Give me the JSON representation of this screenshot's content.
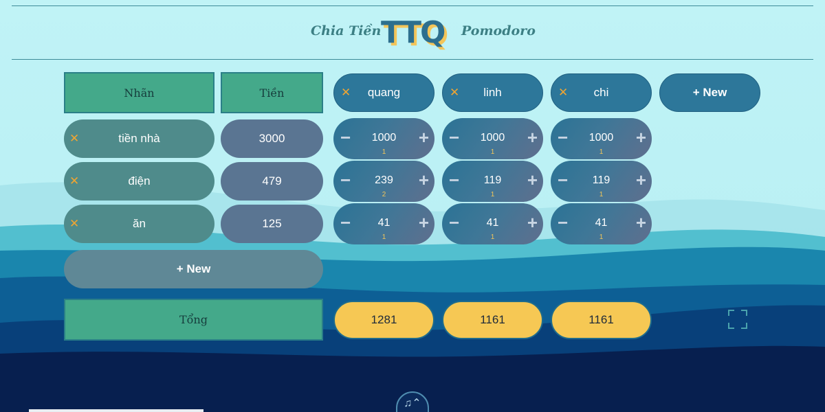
{
  "header": {
    "nav_left": "Chia Tiền",
    "logo": "TTQ",
    "nav_right": "Pomodoro"
  },
  "table": {
    "label_header": "Nhãn",
    "amount_header": "Tiền",
    "people": [
      "quang",
      "linh",
      "chi"
    ],
    "new_person_label": "+ New",
    "rows": [
      {
        "label": "tiền nhà",
        "amount": "3000",
        "shares": [
          {
            "value": "1000",
            "weight": "1"
          },
          {
            "value": "1000",
            "weight": "1"
          },
          {
            "value": "1000",
            "weight": "1"
          }
        ]
      },
      {
        "label": "điện",
        "amount": "479",
        "shares": [
          {
            "value": "239",
            "weight": "2"
          },
          {
            "value": "119",
            "weight": "1"
          },
          {
            "value": "119",
            "weight": "1"
          }
        ]
      },
      {
        "label": "ăn",
        "amount": "125",
        "shares": [
          {
            "value": "41",
            "weight": "1"
          },
          {
            "value": "41",
            "weight": "1"
          },
          {
            "value": "41",
            "weight": "1"
          }
        ]
      }
    ],
    "new_row_label": "+ New",
    "total_label": "Tổng",
    "totals": [
      "1281",
      "1161",
      "1161"
    ]
  },
  "icons": {
    "remove": "close-icon",
    "decrease": "minus-icon",
    "increase": "plus-icon",
    "fullscreen": "fullscreen-icon",
    "music": "music-icon"
  },
  "glyphs": {
    "remove": "✕",
    "minus": "−",
    "plus": "+",
    "music": "♫⌃"
  },
  "colors": {
    "accent_gold": "#f6c854",
    "accent_green": "#44a98a",
    "person_blue": "#2d779a",
    "remove_orange": "#f0a531"
  }
}
